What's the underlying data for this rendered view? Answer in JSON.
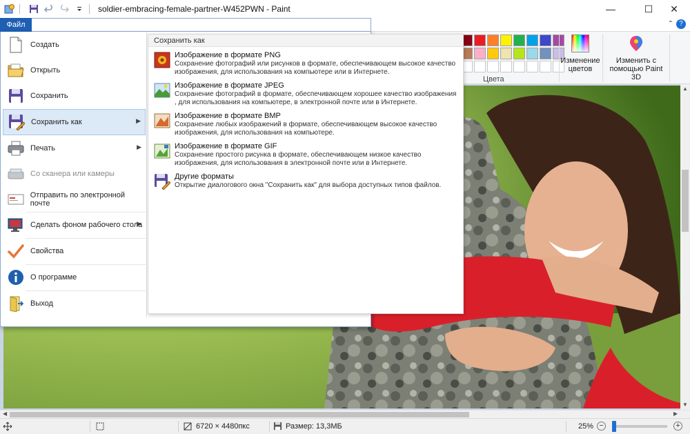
{
  "window": {
    "title": "soldier-embracing-female-partner-W452PWN - Paint",
    "minimize": "—",
    "maximize": "☐",
    "close": "✕"
  },
  "file_tab": "Файл",
  "ribbon": {
    "palette_row1": [
      "#ffffff",
      "#880015",
      "#ed1c24",
      "#ff7f27",
      "#fff200",
      "#22b14c",
      "#00a2e8",
      "#3f48cc",
      "#a349a4"
    ],
    "palette_row2": [
      "#c3c3c3",
      "#b97a57",
      "#ffaec9",
      "#ffc90e",
      "#efe4b0",
      "#b5e61d",
      "#99d9ea",
      "#7092be",
      "#c8bfe7"
    ],
    "colors_label": "Цвета",
    "edit_colors": "Изменение цветов",
    "edit_paint3d": "Изменить с помощью Paint 3D"
  },
  "menu": {
    "items": [
      {
        "label": "Создать",
        "icon": "new-file-icon"
      },
      {
        "label": "Открыть",
        "icon": "open-folder-icon"
      },
      {
        "label": "Сохранить",
        "icon": "save-floppy-icon"
      },
      {
        "label": "Сохранить как",
        "icon": "save-as-icon"
      },
      {
        "label": "Печать",
        "icon": "printer-icon"
      },
      {
        "label": "Со сканера или камеры",
        "icon": "scanner-icon"
      },
      {
        "label": "Отправить по электронной почте",
        "icon": "email-icon"
      },
      {
        "label": "Сделать фоном рабочего стола",
        "icon": "desktop-background-icon"
      },
      {
        "label": "Свойства",
        "icon": "check-mark-icon"
      },
      {
        "label": "О программе",
        "icon": "info-icon"
      },
      {
        "label": "Выход",
        "icon": "exit-icon"
      }
    ]
  },
  "save_as": {
    "header": "Сохранить как",
    "options": [
      {
        "title": "Изображение в формате PNG",
        "desc": "Сохранение фотографий или рисунков в формате, обеспечивающем высокое качество изображения, для использования на компьютере или в Интернете."
      },
      {
        "title": "Изображение в формате JPEG",
        "desc": "Сохранение фотографий в формате, обеспечивающем хорошее качество изображения , для использования на компьютере, в электронной почте или в Интернете."
      },
      {
        "title": "Изображение в формате BMP",
        "desc": "Сохранение любых изображений в формате, обеспечивающем высокое качество изображения, для использования на компьютере."
      },
      {
        "title": "Изображение в формате GIF",
        "desc": "Сохранение простого рисунка в формате, обеспечивающем низкое качество изображения, для использования в электронной почте или в Интернете."
      },
      {
        "title": "Другие форматы",
        "desc": "Открытие диалогового окна \"Сохранить как\" для выбора доступных типов файлов."
      }
    ]
  },
  "status": {
    "dimensions": "6720 × 4480пкс",
    "size": "Размер: 13,3МБ",
    "zoom": "25%",
    "zoom_level": 0.25
  }
}
